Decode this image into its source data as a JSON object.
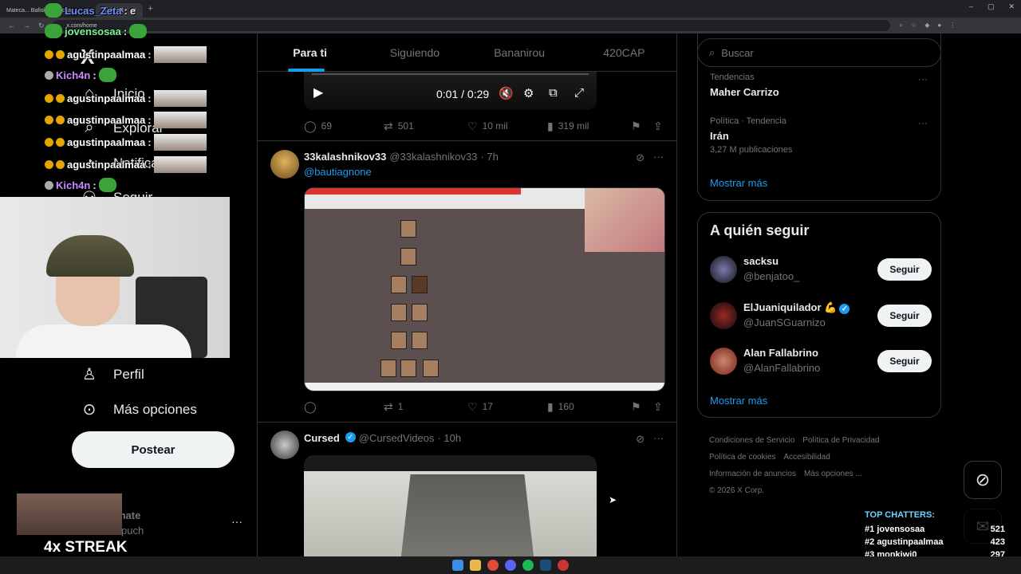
{
  "browser": {
    "tabs": [
      {
        "label": "Mateca... Bafiskina Racha..."
      },
      {
        "label": "Inicio / X"
      }
    ],
    "url": "x.com/home",
    "window_controls": [
      "–",
      "▢",
      "✕"
    ]
  },
  "sidebar": {
    "logo": "X",
    "items": [
      {
        "label": "Inicio",
        "icon": "home-icon"
      },
      {
        "label": "Explorar",
        "icon": "search-icon"
      },
      {
        "label": "Notificaciones",
        "icon": "bell-icon"
      },
      {
        "label": "Seguir",
        "icon": "follow-icon"
      },
      {
        "label": "Perfil",
        "icon": "person-icon"
      },
      {
        "label": "Más opciones",
        "icon": "more-circle-icon"
      }
    ],
    "post_button": "Postear",
    "account_name": "mate",
    "account_handle": "puch"
  },
  "feed": {
    "tabs": [
      "Para ti",
      "Siguiendo",
      "Bananirou",
      "420CAP"
    ],
    "active_tab": "Para ti",
    "video": {
      "time": "0:01 / 0:29"
    },
    "tweet1_actions": {
      "replies": "69",
      "reposts": "501",
      "likes": "10 mil",
      "views": "319 mil"
    },
    "tweet2": {
      "name": "33kalashnikov33",
      "handle": "@33kalashnikov33",
      "time": "· 7h",
      "mention": "@bautiagnone",
      "actions": {
        "replies": "",
        "reposts": "1",
        "likes": "17",
        "views": "160"
      }
    },
    "tweet3": {
      "name": "Cursed",
      "handle": "@CursedVideos",
      "time": "· 10h"
    }
  },
  "right": {
    "search_placeholder": "Buscar",
    "trends": [
      {
        "meta": "Tendencias",
        "title": "Maher Carrizo",
        "count": ""
      },
      {
        "meta": "Política · Tendencia",
        "title": "Irán",
        "count": "3,27 M publicaciones"
      }
    ],
    "trends_more": "Mostrar más",
    "who_to_follow_title": "A quién seguir",
    "who_to_follow": [
      {
        "name": "sacksu",
        "handle": "@benjatoo_",
        "button": "Seguir",
        "verified": false
      },
      {
        "name": "ElJuaniquilador 💪",
        "handle": "@JuanSGuarnizo",
        "button": "Seguir",
        "verified": true
      },
      {
        "name": "Alan Fallabrino",
        "handle": "@AlanFallabrino",
        "button": "Seguir",
        "verified": false
      }
    ],
    "follow_more": "Mostrar más",
    "footer": {
      "links": [
        "Condiciones de Servicio",
        "Política de Privacidad",
        "Política de cookies",
        "Accesibilidad",
        "Información de anuncios",
        "Más opciones ..."
      ],
      "copyright": "© 2026 X Corp."
    }
  },
  "stream": {
    "chat": [
      {
        "user": "Lucas_Zeta",
        "text": "e",
        "color": "#6e8cff"
      },
      {
        "user": "jovensosaa",
        "text": "",
        "color": "#7cf29a"
      },
      {
        "user": "agustinpaalmaa",
        "text": "",
        "color": "#ffffff"
      },
      {
        "user": "Kich4n",
        "text": "",
        "color": "#c98bff"
      },
      {
        "user": "agustinpaalmaa",
        "text": "",
        "color": "#ffffff"
      },
      {
        "user": "agustinpaalmaa",
        "text": "",
        "color": "#ffffff"
      },
      {
        "user": "agustinpaalmaa",
        "text": "",
        "color": "#ffffff"
      },
      {
        "user": "agustinpaalmaa",
        "text": "",
        "color": "#ffffff"
      },
      {
        "user": "Kich4n",
        "text": "",
        "color": "#c98bff"
      }
    ],
    "streak": "4x STREAK",
    "top_chatters_title": "TOP CHATTERS:",
    "top_chatters": [
      {
        "rank": "#1",
        "name": "jovensosaa",
        "count": "521"
      },
      {
        "rank": "#2",
        "name": "agustinpaalmaa",
        "count": "423"
      },
      {
        "rank": "#3",
        "name": "monkiwi0",
        "count": "297"
      }
    ]
  }
}
